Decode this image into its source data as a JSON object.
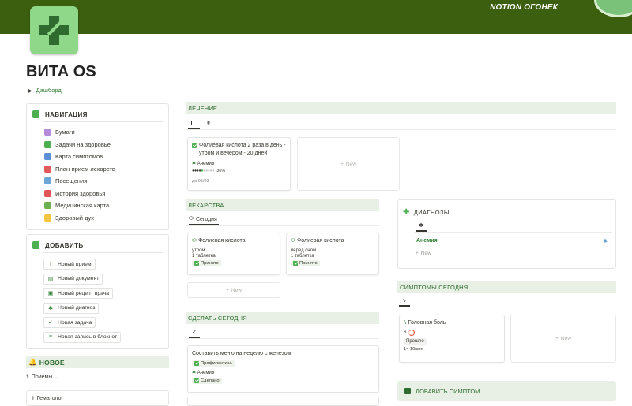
{
  "banner": {
    "brand": "NOTION ОГОНЕК"
  },
  "page": {
    "title": "ВИТА OS",
    "breadcrumb": "Дашборд"
  },
  "nav": {
    "heading": "НАВИГАЦИЯ",
    "items": [
      {
        "label": "Бумаги",
        "icon": "papers-icon",
        "color": "#b58bd9"
      },
      {
        "label": "Задачи на здоровье",
        "icon": "check-circle-icon",
        "color": "#4caf50"
      },
      {
        "label": "Карта симптомов",
        "icon": "map-icon",
        "color": "#5b8fd6"
      },
      {
        "label": "План-прием лекарств",
        "icon": "pills-icon",
        "color": "#e25b5b"
      },
      {
        "label": "Посещения",
        "icon": "hospital-icon",
        "color": "#6aa6d8"
      },
      {
        "label": "История здоровья",
        "icon": "pin-icon",
        "color": "#e05555"
      },
      {
        "label": "Медицинская карта",
        "icon": "card-icon",
        "color": "#6ab04c"
      },
      {
        "label": "Здоровый дух",
        "icon": "sun-icon",
        "color": "#f4c542"
      }
    ]
  },
  "add": {
    "heading": "ДОБАВИТЬ",
    "buttons": [
      {
        "label": "Новый прием",
        "icon": "stethoscope-icon",
        "glyph": "⚕"
      },
      {
        "label": "Новый документ",
        "icon": "document-icon",
        "glyph": "▤"
      },
      {
        "label": "Новый рецепт врача",
        "icon": "prescription-icon",
        "glyph": "▣"
      },
      {
        "label": "Новый диагноз",
        "icon": "asterisk-icon",
        "glyph": "✱"
      },
      {
        "label": "Новая задача",
        "icon": "checkmark-icon",
        "glyph": "✓"
      },
      {
        "label": "Новая запись в блокнот",
        "icon": "note-icon",
        "glyph": "≡"
      }
    ]
  },
  "new_section": {
    "heading": "НОВОЕ",
    "filter": "Приемы",
    "row": "Гематолог"
  },
  "treatment": {
    "heading": "ЛЕЧЕНИЕ",
    "card": {
      "title": "Фолиевая кислота 2 раза в день - утром и вечером - 20 дней",
      "condition": "Анемия",
      "progress_label": "36%",
      "progress": 0.36,
      "due": "до 05/03"
    },
    "new_label": "New"
  },
  "meds": {
    "heading": "ЛЕКАРСТВА",
    "tab": "Сегодня",
    "cards": [
      {
        "title": "Фолиевая кислота",
        "time": "утром",
        "dose": "1 таблетка",
        "status": "Принято"
      },
      {
        "title": "Фолиевая кислота",
        "time": "перед сном",
        "dose": "1 таблетка",
        "status": "Принято"
      }
    ],
    "new_label": "New"
  },
  "today": {
    "heading": "СДЕЛАТЬ СЕГОДНЯ",
    "card": {
      "title": "Составить меню на неделю с железом",
      "tag": "Профилактика",
      "condition": "Анемия",
      "status": "Сделано"
    }
  },
  "diagnoses": {
    "heading": "ДИАГНОЗЫ",
    "item": "Анемия",
    "new_label": "New"
  },
  "symptoms": {
    "heading": "СИМПТОМЫ СЕГОДНЯ",
    "card": {
      "title": "Головная боль",
      "level": "6",
      "status": "Прошло",
      "duration": "1ч 10мин"
    },
    "new_label": "New"
  },
  "add_symptom": {
    "label": "ДОБАВИТЬ СИМПТОМ"
  },
  "colors": {
    "banner": "#3b5e0f",
    "accent": "#4caf50",
    "section": "#e8f0e6"
  }
}
